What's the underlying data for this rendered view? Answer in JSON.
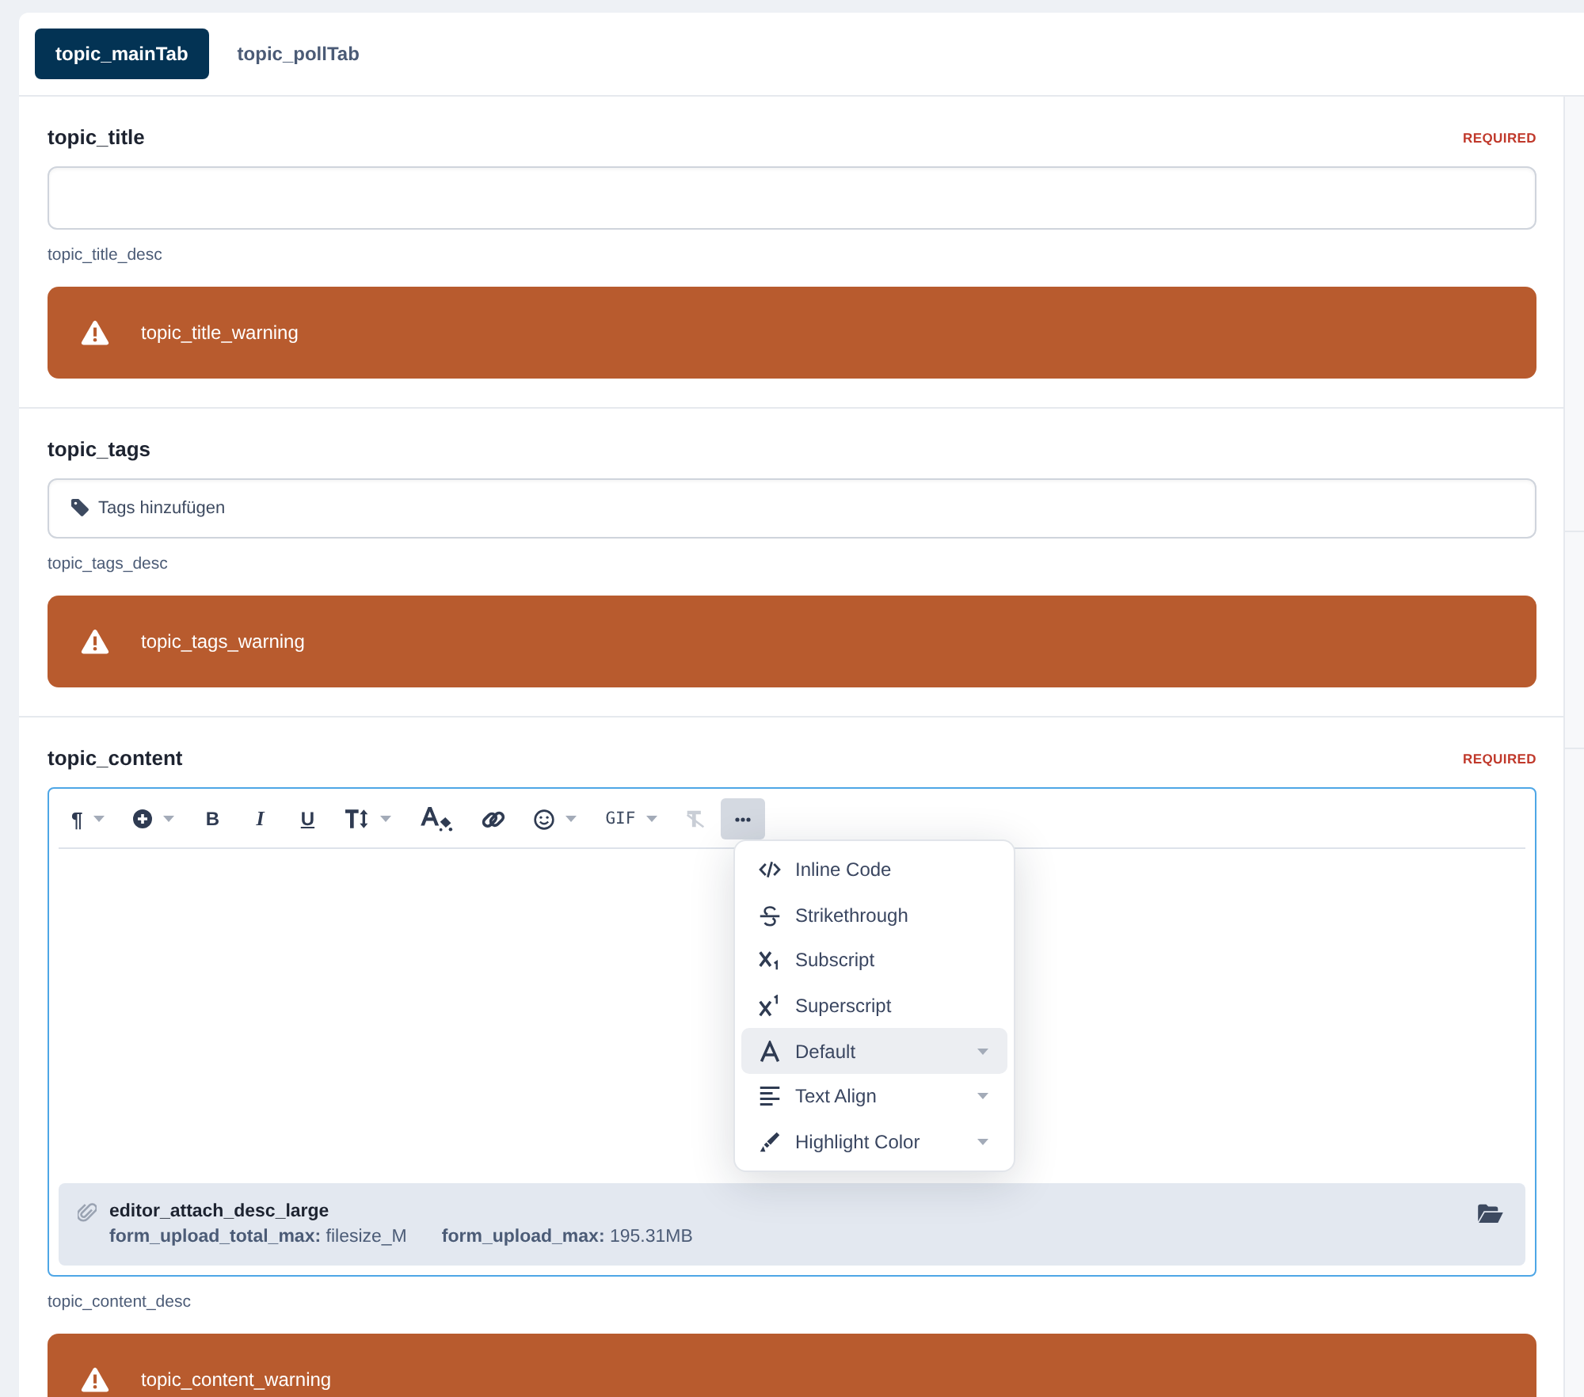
{
  "tabs": [
    {
      "label": "topic_mainTab",
      "selected": true
    },
    {
      "label": "topic_pollTab",
      "selected": false
    }
  ],
  "fields": [
    {
      "kind": "text",
      "label": "topic_title",
      "required": "REQUIRED",
      "description": "topic_title_desc",
      "warning": "topic_title_warning"
    },
    {
      "kind": "tags",
      "label": "topic_tags",
      "placeholder": "Tags hinzufügen",
      "description": "topic_tags_desc",
      "warning": "topic_tags_warning"
    },
    {
      "kind": "editor",
      "label": "topic_content",
      "required": "REQUIRED",
      "focused": true,
      "toolbar": [
        {
          "label": "¶",
          "dropdown": true,
          "disabled": false,
          "selected": false
        },
        {
          "dropdown": true,
          "disabled": false,
          "selected": false
        },
        {
          "label": "B",
          "dropdown": false,
          "disabled": false,
          "selected": false
        },
        {
          "label": "I",
          "dropdown": false,
          "disabled": false,
          "selected": false
        },
        {
          "label": "U",
          "dropdown": false,
          "disabled": false,
          "selected": false
        },
        {
          "dropdown": true,
          "disabled": false,
          "selected": false
        },
        {
          "dropdown": false,
          "disabled": false,
          "selected": false
        },
        {
          "dropdown": false,
          "disabled": false,
          "selected": false
        },
        {
          "dropdown": true,
          "disabled": false,
          "selected": false
        },
        {
          "label": "GIF",
          "dropdown": true,
          "disabled": false,
          "selected": false
        },
        {
          "dropdown": false,
          "disabled": true,
          "selected": false
        },
        {
          "dropdown": false,
          "disabled": false,
          "selected": true
        }
      ],
      "menu": [
        {
          "label": "Inline Code",
          "submenu": false,
          "selected": false
        },
        {
          "label": "Strikethrough",
          "submenu": false,
          "selected": false
        },
        {
          "label": "Subscript",
          "submenu": false,
          "selected": false
        },
        {
          "label": "Superscript",
          "submenu": false,
          "selected": false
        },
        {
          "label": "Default",
          "submenu": true,
          "selected": true
        },
        {
          "label": "Text Align",
          "submenu": true,
          "selected": false
        },
        {
          "label": "Highlight Color",
          "submenu": true,
          "selected": false
        }
      ],
      "attachments": {
        "title": "editor_attach_desc_large",
        "limits": [
          "**form_upload_total_max:** filesize_M",
          "**form_upload_max:** 195.31MB"
        ]
      },
      "description": "topic_content_desc",
      "warning": "topic_content_warning"
    }
  ]
}
